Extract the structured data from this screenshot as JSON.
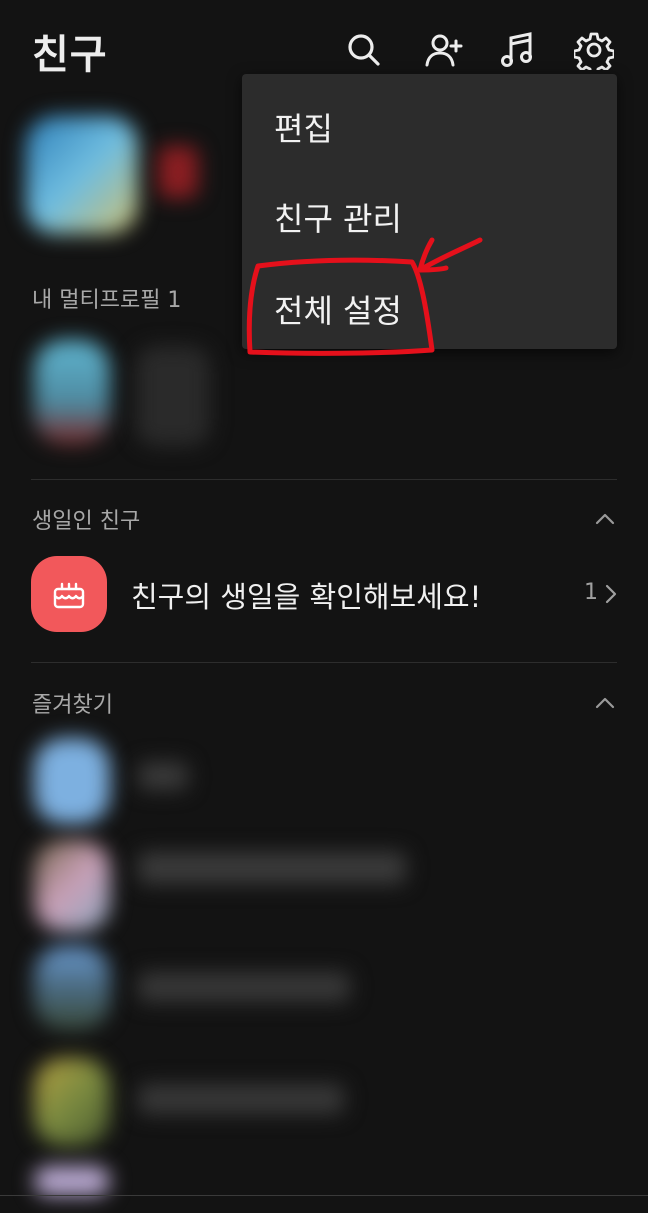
{
  "header": {
    "title": "친구",
    "icons": [
      "search-icon",
      "add-friend-icon",
      "music-icon",
      "settings-icon"
    ]
  },
  "sections": {
    "multiprofile_label": "내 멀티프로필 1",
    "birthday_label": "생일인 친구",
    "favorites_label": "즐겨찾기"
  },
  "birthday": {
    "message": "친구의 생일을 확인해보세요!",
    "count": "1",
    "icon": "cake-icon"
  },
  "menu": {
    "items": [
      {
        "label": "편집"
      },
      {
        "label": "친구 관리"
      },
      {
        "label": "전체 설정"
      }
    ],
    "highlighted_item": "전체 설정"
  },
  "colors": {
    "background": "#131313",
    "menu_background": "#2c2c2c",
    "birthday_icon": "#f2585b",
    "annotation": "#e5101b"
  }
}
